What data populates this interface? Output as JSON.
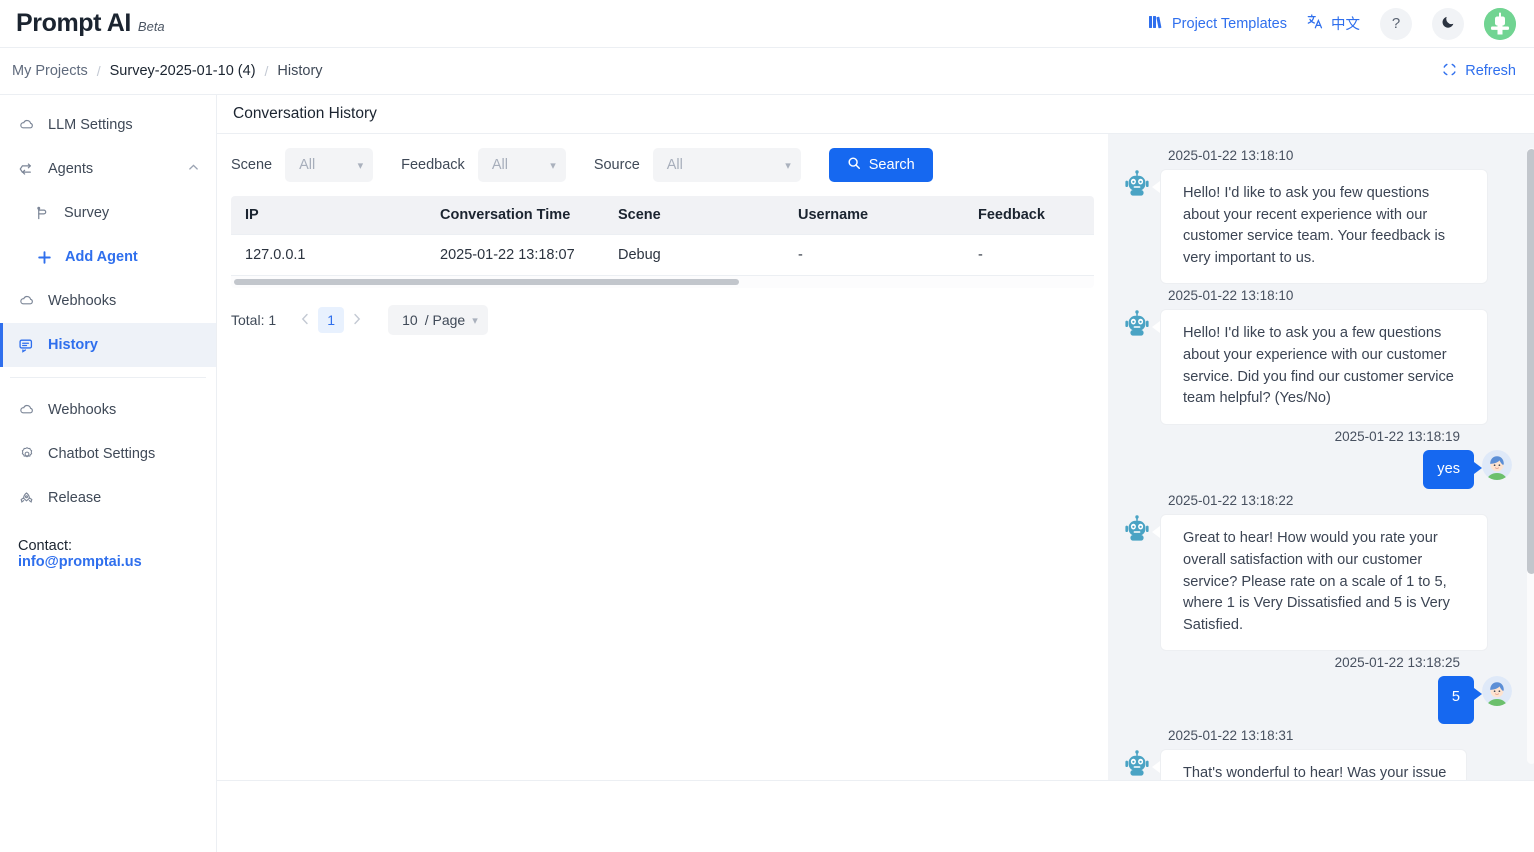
{
  "header": {
    "brand_name": "Prompt AI",
    "brand_badge": "Beta",
    "project_templates": "Project Templates",
    "language": "中文",
    "help_label": "?",
    "templates_icon": "book-icon",
    "translate_icon": "translate-icon",
    "help_icon": "question-mark-icon",
    "theme_icon": "moon-icon",
    "avatar_icon": "user-avatar"
  },
  "breadcrumb": {
    "items": [
      {
        "label": "My Projects"
      },
      {
        "label": "Survey-2025-01-10 (4)"
      },
      {
        "label": "History"
      }
    ],
    "separator": "/",
    "refresh_label": "Refresh",
    "refresh_icon": "refresh-icon"
  },
  "sidebar": {
    "items": [
      {
        "label": "LLM Settings",
        "icon": "cloud-icon",
        "active": false
      },
      {
        "label": "Agents",
        "icon": "branch-icon",
        "active": false
      },
      {
        "label": "Survey",
        "icon": "flow-icon",
        "active": false
      },
      {
        "label": "Add Agent",
        "icon": "plus-icon",
        "active": false
      },
      {
        "label": "Webhooks",
        "icon": "cloud-icon",
        "active": false
      },
      {
        "label": "History",
        "icon": "chat-history-icon",
        "active": true
      },
      {
        "label": "Webhooks",
        "icon": "cloud-icon",
        "active": false
      },
      {
        "label": "Chatbot Settings",
        "icon": "gear-icon",
        "active": false
      },
      {
        "label": "Release",
        "icon": "rocket-icon",
        "active": false
      }
    ],
    "contact_label": "Contact:",
    "contact_email": "info@promptai.us"
  },
  "main": {
    "card_title": "Conversation History",
    "filters": [
      {
        "label": "Scene",
        "value": "All",
        "width": "narrow"
      },
      {
        "label": "Feedback",
        "value": "All",
        "width": "narrow"
      },
      {
        "label": "Source",
        "value": "All",
        "width": "wide"
      }
    ],
    "search_button": "Search",
    "search_icon": "search-icon",
    "table": {
      "columns": [
        "IP",
        "Conversation Time",
        "Scene",
        "Username",
        "Feedback"
      ],
      "rows": [
        [
          "127.0.0.1",
          "2025-01-22 13:18:07",
          "Debug",
          "-",
          "-"
        ]
      ]
    },
    "pagination": {
      "total_label": "Total: 1",
      "prev_icon": "chevron-left-icon",
      "next_icon": "chevron-right-icon",
      "current_page": "1",
      "page_size": "10",
      "page_size_suffix": "/ Page"
    }
  },
  "chat": {
    "messages": [
      {
        "sender": "bot",
        "timestamp": "2025-01-22 13:18:10",
        "text": "Hello! I'd like to ask you few questions about your recent experience with our customer service team. Your feedback is very important to us."
      },
      {
        "sender": "bot",
        "timestamp": "2025-01-22 13:18:10",
        "text": "Hello! I'd like to ask you a few questions about your experience with our customer service. Did you find our customer service team helpful? (Yes/No)"
      },
      {
        "sender": "user",
        "timestamp": "2025-01-22 13:18:19",
        "text": "yes"
      },
      {
        "sender": "bot",
        "timestamp": "2025-01-22 13:18:22",
        "text": "Great to hear! How would you rate your overall satisfaction with our customer service? Please rate on a scale of 1 to 5, where 1 is Very Dissatisfied and 5 is Very Satisfied."
      },
      {
        "sender": "user",
        "timestamp": "2025-01-22 13:18:25",
        "text": "5"
      },
      {
        "sender": "bot",
        "timestamp": "2025-01-22 13:18:31",
        "text": "That's wonderful to hear! Was your issue"
      }
    ],
    "bot_avatar_icon": "robot-avatar",
    "user_avatar_icon": "person-avatar"
  },
  "colors": {
    "accent": "#2f6fed",
    "primary_button": "#1668f0",
    "bot_avatar": "#4aa3c4",
    "chat_bg": "#f2f4f7",
    "top_avatar": "#71d492"
  }
}
